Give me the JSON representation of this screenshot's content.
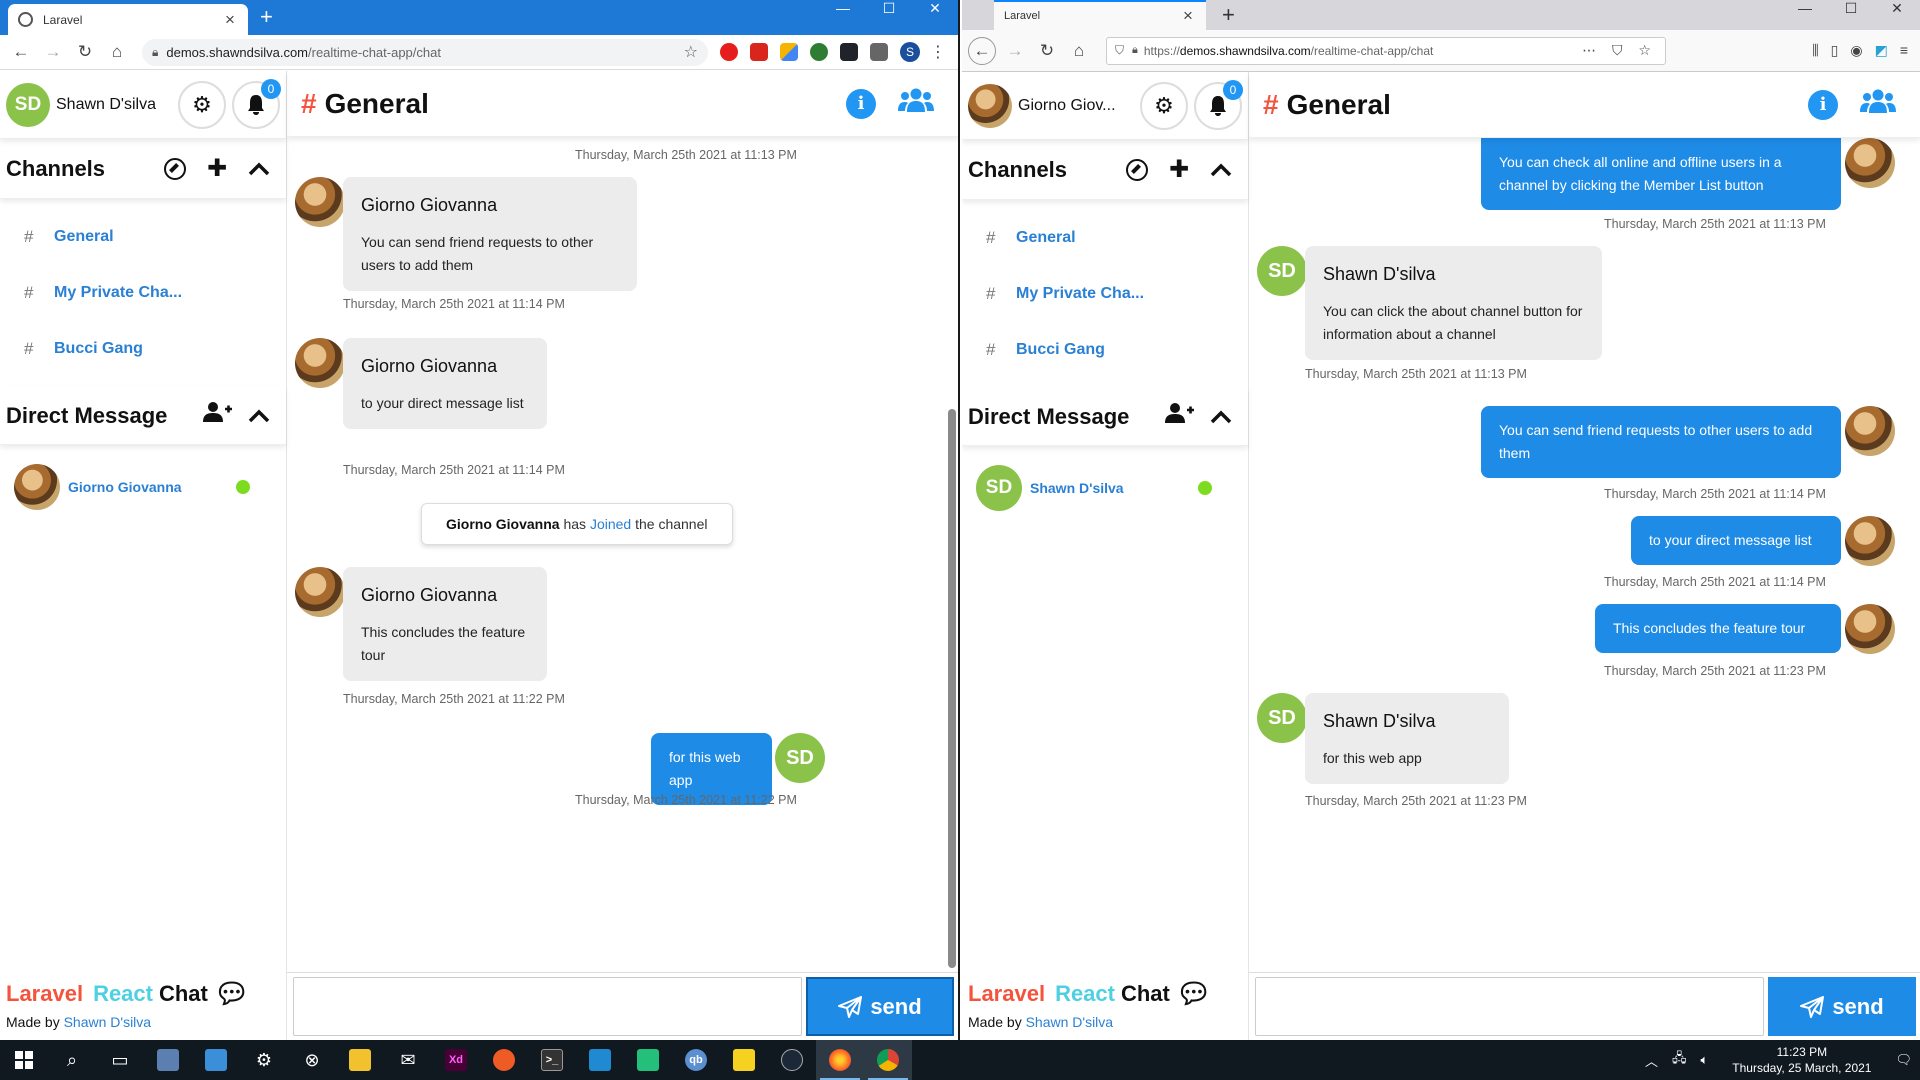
{
  "left_browser": {
    "tab_title": "Laravel",
    "url_host": "demos.shawndsilva.com",
    "url_path": "/realtime-chat-app/chat",
    "profile_initial": "S"
  },
  "right_browser": {
    "tab_title": "Laravel",
    "url_scheme": "https://",
    "url_host": "demos.shawndsilva.com",
    "url_path": "/realtime-chat-app/chat"
  },
  "left_app": {
    "user": {
      "initials": "SD",
      "name": "Shawn D'silva"
    },
    "notification_count": "0",
    "channels_title": "Channels",
    "channels": [
      {
        "hash": "#",
        "name": "General"
      },
      {
        "hash": "#",
        "name": "My Private Cha..."
      },
      {
        "hash": "#",
        "name": "Bucci Gang"
      }
    ],
    "dm_title": "Direct Message",
    "dms": [
      {
        "name": "Giorno Giovanna",
        "status": "online"
      }
    ],
    "brand": {
      "laravel": "Laravel",
      "react": "React",
      "chat": "Chat",
      "made_by": "Made by",
      "author": "Shawn D'silva"
    },
    "chat": {
      "hash": "#",
      "title": "General",
      "info_label": "i",
      "send_label": "send",
      "messages": [
        {
          "time": "Thursday, March 25th 2021 at 11:13 PM"
        },
        {
          "sender": "Giorno Giovanna",
          "text": "You can send friend requests to other users to add them",
          "time": "Thursday, March 25th 2021 at 11:14 PM"
        },
        {
          "sender": "Giorno Giovanna",
          "text": "to your direct message list",
          "time": "Thursday, March 25th 2021 at 11:14 PM"
        },
        {
          "system_user": "Giorno Giovanna",
          "system_has": "has",
          "system_action": "Joined",
          "system_rest": "the channel"
        },
        {
          "sender": "Giorno Giovanna",
          "text": "This concludes the feature tour",
          "time": "Thursday, March 25th 2021 at 11:22 PM"
        },
        {
          "initials": "SD",
          "text": "for this web app",
          "time": "Thursday, March 25th 2021 at 11:22 PM"
        }
      ]
    }
  },
  "right_app": {
    "user": {
      "name": "Giorno Giov..."
    },
    "notification_count": "0",
    "channels_title": "Channels",
    "channels": [
      {
        "hash": "#",
        "name": "General"
      },
      {
        "hash": "#",
        "name": "My Private Cha..."
      },
      {
        "hash": "#",
        "name": "Bucci Gang"
      }
    ],
    "dm_title": "Direct Message",
    "dms": [
      {
        "initials": "SD",
        "name": "Shawn D'silva",
        "status": "online"
      }
    ],
    "brand": {
      "laravel": "Laravel",
      "react": "React",
      "chat": "Chat",
      "made_by": "Made by",
      "author": "Shawn D'silva"
    },
    "chat": {
      "hash": "#",
      "title": "General",
      "info_label": "i",
      "send_label": "send",
      "messages": [
        {
          "text": "You can check all online and offline users in a channel by clicking the Member List button",
          "time": "Thursday, March 25th 2021 at 11:13 PM"
        },
        {
          "initials": "SD",
          "sender": "Shawn D'silva",
          "text": "You can click the about channel button for information about a channel",
          "time": "Thursday, March 25th 2021 at 11:13 PM"
        },
        {
          "text": "You can send friend requests to other users to add them",
          "time": "Thursday, March 25th 2021 at 11:14 PM"
        },
        {
          "text": "to your direct message list",
          "time": "Thursday, March 25th 2021 at 11:14 PM"
        },
        {
          "text": "This concludes the feature tour",
          "time": "Thursday, March 25th 2021 at 11:23 PM"
        },
        {
          "initials": "SD",
          "sender": "Shawn D'silva",
          "text": "for this web app",
          "time": "Thursday, March 25th 2021 at 11:23 PM"
        }
      ]
    }
  },
  "taskbar": {
    "time": "11:23 PM",
    "date": "Thursday, 25 March, 2021",
    "apps": [
      "start",
      "search",
      "task-view",
      "settings",
      "xbox",
      "file-explorer",
      "mail",
      "adobe-xd",
      "postman",
      "terminal",
      "vscode",
      "vscode-insiders",
      "qbittorrent",
      "player",
      "steam",
      "firefox",
      "chrome"
    ]
  },
  "colors": {
    "accent": "#1e8be6",
    "brand_red": "#f4533c",
    "brand_cyan": "#4dd0e1",
    "online": "#7ddc1f",
    "sd_avatar": "#8bc34a"
  }
}
